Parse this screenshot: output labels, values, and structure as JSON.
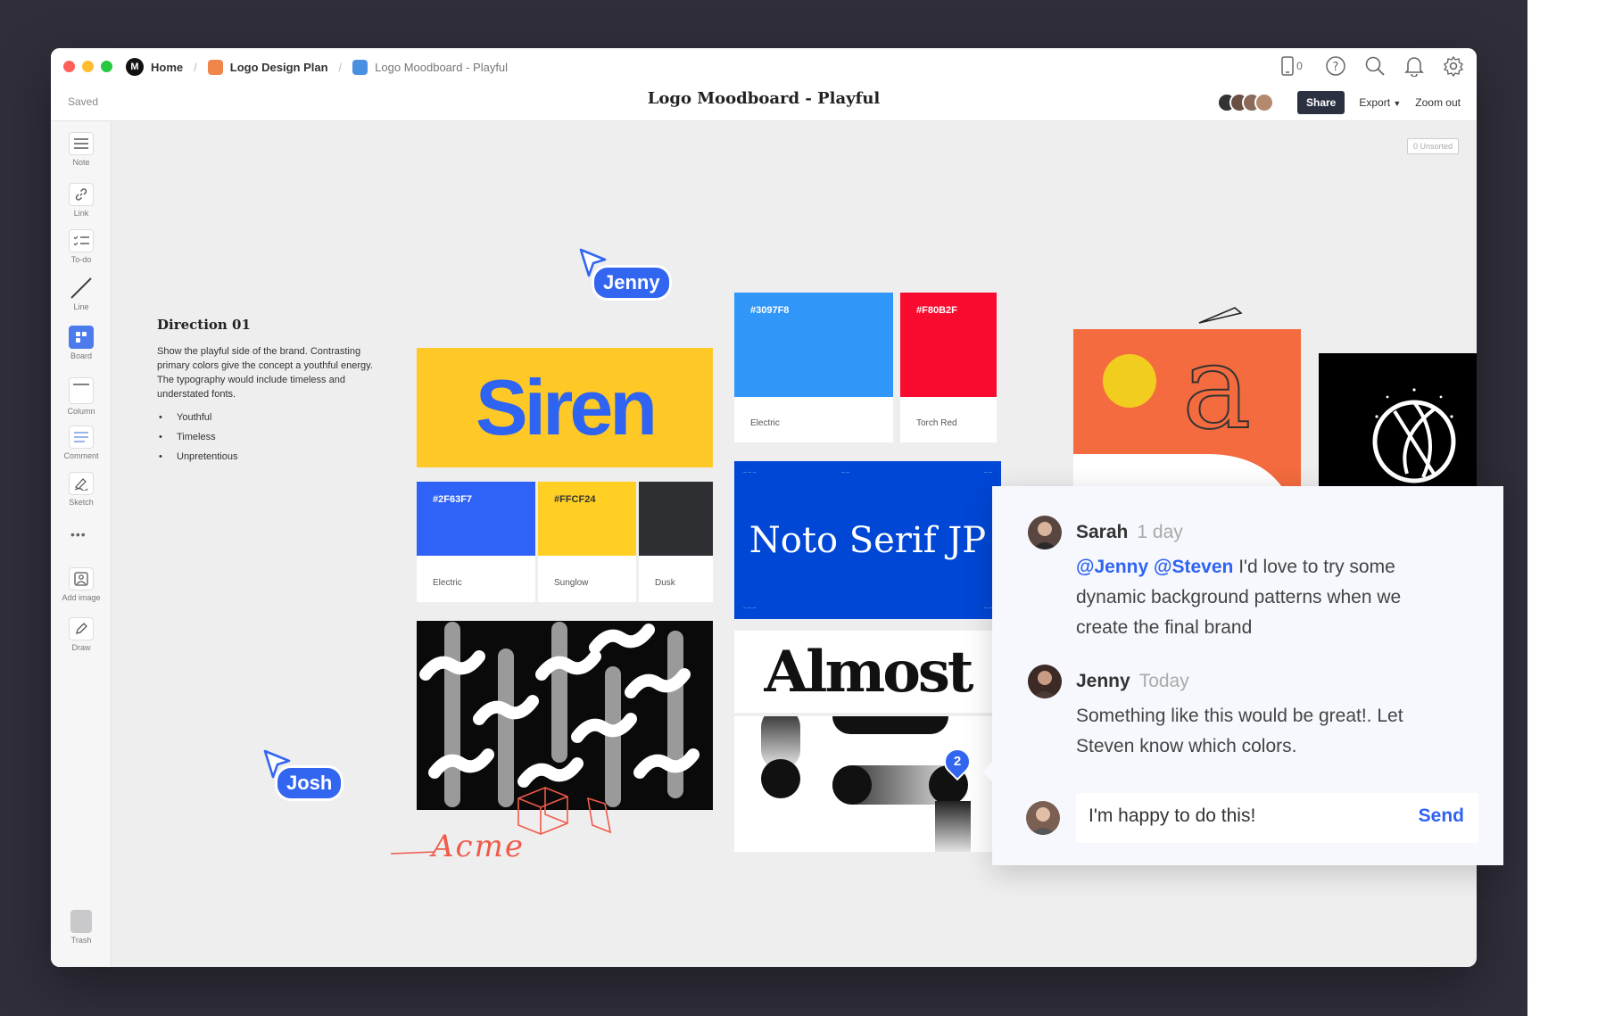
{
  "breadcrumbs": [
    {
      "label": "Home",
      "color": "#111111"
    },
    {
      "label": "Logo Design Plan",
      "color": "#f0864a"
    },
    {
      "label": "Logo Moodboard - Playful",
      "color": "#4a90e2"
    }
  ],
  "status": "Saved",
  "doc_title": "Logo Moodboard - Playful",
  "header": {
    "device_count": "0",
    "share_label": "Share",
    "export_label": "Export",
    "zoom_label": "Zoom out"
  },
  "tools": [
    {
      "label": "Note",
      "icon": "note-icon"
    },
    {
      "label": "Link",
      "icon": "link-icon"
    },
    {
      "label": "To-do",
      "icon": "todo-icon"
    },
    {
      "label": "Line",
      "icon": "line-icon"
    },
    {
      "label": "Board",
      "icon": "board-icon"
    },
    {
      "label": "Column",
      "icon": "column-icon"
    },
    {
      "label": "Comment",
      "icon": "comment-icon"
    },
    {
      "label": "Sketch",
      "icon": "sketch-icon"
    },
    {
      "label": "Add image",
      "icon": "image-icon"
    },
    {
      "label": "Draw",
      "icon": "pencil-icon"
    },
    {
      "label": "Trash",
      "icon": "trash-icon"
    }
  ],
  "canvas": {
    "unsorted": "0 Unsorted",
    "direction": {
      "title": "Direction 01",
      "body": "Show the playful side of the brand. Contrasting primary colors give the concept a youthful energy. The typography would include timeless and understated fonts.",
      "bullets": [
        "Youthful",
        "Timeless",
        "Unpretentious"
      ]
    },
    "siren_text": "Siren",
    "swatches_row": [
      {
        "hex": "#2F63F7",
        "name": "Electric",
        "color": "#2f63f7",
        "text_color": "#ffffff"
      },
      {
        "hex": "#FFCF24",
        "name": "Sunglow",
        "color": "#ffcf24",
        "text_color": "#333333"
      },
      {
        "hex": "",
        "name": "Dusk",
        "color": "#2e2f33",
        "text_color": "#ffffff"
      }
    ],
    "swatches_top": [
      {
        "hex": "#3097F8",
        "name": "Electric",
        "color": "#3097f8"
      },
      {
        "hex": "#F80B2F",
        "name": "Torch Red",
        "color": "#f80b2f"
      }
    ],
    "noto_text": "Noto Serif JP",
    "almost_text": "Almost",
    "sketch_word": "Acme",
    "cursors": [
      {
        "name": "Jenny"
      },
      {
        "name": "Josh"
      }
    ],
    "pin_count": "2"
  },
  "comments": [
    {
      "author": "Sarah",
      "time": "1 day",
      "mentions": "@Jenny @Steven",
      "text": " I'd love to try some dynamic background patterns when we create the final brand"
    },
    {
      "author": "Jenny",
      "time": "Today",
      "mentions": "",
      "text": "Something like this would be great!. Let Steven know which colors."
    }
  ],
  "reply": {
    "value": "I'm happy to do this!",
    "send_label": "Send"
  },
  "colors": {
    "accent": "#3366f0",
    "backdrop": "#2f2e3a",
    "siren_yellow": "#fec926",
    "noto_blue": "#0047d6",
    "orange": "#f36b3e"
  }
}
